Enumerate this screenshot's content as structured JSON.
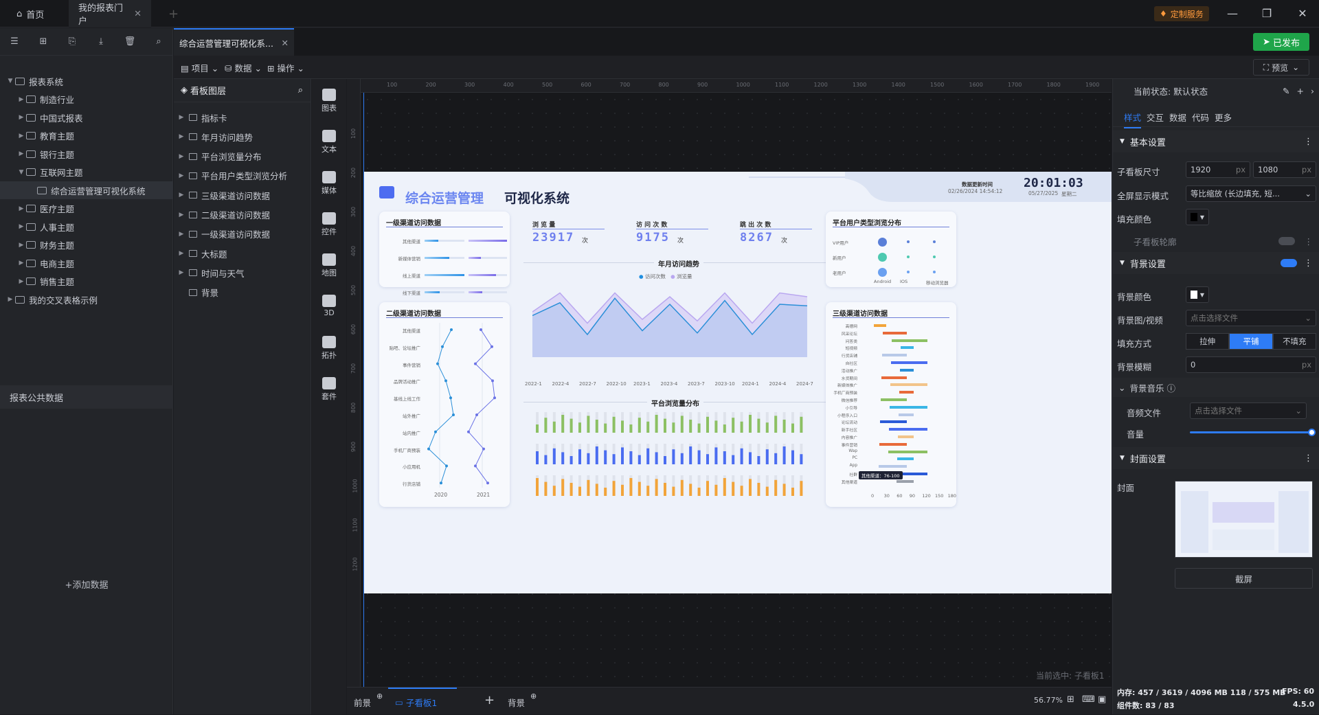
{
  "titlebar": {
    "home": "首页",
    "portal_tab": "我的报表门户",
    "custom_service": "定制服务"
  },
  "sidebar": {
    "tree": [
      {
        "label": "报表系统",
        "level": 0,
        "expanded": true
      },
      {
        "label": "制造行业",
        "level": 1
      },
      {
        "label": "中国式报表",
        "level": 1
      },
      {
        "label": "教育主题",
        "level": 1
      },
      {
        "label": "银行主题",
        "level": 1
      },
      {
        "label": "互联网主题",
        "level": 1,
        "expanded": true
      },
      {
        "label": "综合运营管理可视化系统",
        "level": 2,
        "selected": true
      },
      {
        "label": "医疗主题",
        "level": 1
      },
      {
        "label": "人事主题",
        "level": 1
      },
      {
        "label": "财务主题",
        "level": 1
      },
      {
        "label": "电商主题",
        "level": 1
      },
      {
        "label": "销售主题",
        "level": 1
      },
      {
        "label": "我的交叉表格示例",
        "level": 0
      }
    ],
    "public_data": "报表公共数据",
    "add_data": "+添加数据"
  },
  "doc": {
    "tab": "综合运营管理可视化系...",
    "published": "已发布",
    "preview": "预览"
  },
  "menubar": {
    "project": "项目",
    "data": "数据",
    "operation": "操作"
  },
  "layers": {
    "title": "看板图层",
    "items": [
      "指标卡",
      "年月访问趋势",
      "平台浏览量分布",
      "平台用户类型浏览分析",
      "三级渠道访问数据",
      "二级渠道访问数据",
      "一级渠道访问数据",
      "大标题",
      "时间与天气",
      "背景"
    ]
  },
  "components": [
    "图表",
    "文本",
    "媒体",
    "控件",
    "地图",
    "3D",
    "拓扑",
    "套件"
  ],
  "rulers": {
    "h": [
      "100",
      "200",
      "300",
      "400",
      "500",
      "600",
      "700",
      "800",
      "900",
      "1000",
      "1100",
      "1200",
      "1300",
      "1400",
      "1500",
      "1600",
      "1700",
      "1800",
      "1900"
    ],
    "v": [
      "100",
      "200",
      "300",
      "400",
      "500",
      "600",
      "700",
      "800",
      "900",
      "1000",
      "1100",
      "1200"
    ]
  },
  "board": {
    "title_a": "综合运营管理",
    "title_b": "可视化系统",
    "update_label": "数据更新时间",
    "update_value": "02/26/2024 14:54:12",
    "clock": "20:01:03",
    "date": "05/27/2025",
    "weekday": "星期二",
    "kpis": [
      {
        "label": "浏 览 量",
        "value": "23917",
        "unit": "次"
      },
      {
        "label": "访 问 次 数",
        "value": "9175",
        "unit": "次"
      },
      {
        "label": "跳 出 次 数",
        "value": "8267",
        "unit": "次"
      }
    ],
    "c1_title": "一级渠道访问数据",
    "c1_rows": [
      "其他渠道",
      "新媒体营销",
      "线上渠道",
      "线下渠道"
    ],
    "c2_title": "二级渠道访问数据",
    "c2_rows": [
      "其他渠道",
      "贴吧、论坛推广",
      "事件营销",
      "品牌活动推广",
      "基线上线工作",
      "站外推广",
      "站内推广",
      "手机厂商预装",
      "小应用机",
      "行货店铺"
    ],
    "c2_years": [
      "2020",
      "2021"
    ],
    "c3_title": "平台用户类型浏览分布",
    "c3_rows": [
      "VIP用户",
      "新用户",
      "老用户"
    ],
    "c3_cols": [
      "Android",
      "IOS",
      "移动浏览器"
    ],
    "c4_title": "三级渠道访问数据",
    "c4_rows": [
      "高德网",
      "风采论坛",
      "问答类",
      "短视频",
      "行货店铺",
      "自社区",
      "活动推广",
      "水货期间",
      "新媒体推广",
      "手机厂商预装",
      "微信推荐",
      "小引导",
      "小程序入口",
      "论坛流动",
      "新手社区",
      "内容推广",
      "事件营销",
      "Wap",
      "PC",
      "App",
      "社群",
      "其他渠道"
    ],
    "c4_ticks": [
      "0",
      "30",
      "60",
      "90",
      "120",
      "150",
      "180"
    ],
    "c4_tooltip": "其他渠道：76-100",
    "trend_title": "年月访问趋势",
    "trend_legend": [
      "访问次数",
      "浏览量"
    ],
    "trend_x": [
      "2022-1",
      "2022-4",
      "2022-7",
      "2022-10",
      "2023-1",
      "2023-4",
      "2023-7",
      "2023-10",
      "2024-1",
      "2024-4",
      "2024-7"
    ],
    "dist_title": "平台浏览量分布"
  },
  "canvas_status": "当前选中: 子看板1",
  "bottom": {
    "front": "前景",
    "board": "子看板1",
    "back": "背景",
    "zoom": "56.77%"
  },
  "right": {
    "state_label": "当前状态: 默认状态",
    "tabs": [
      "样式",
      "交互",
      "数据",
      "代码",
      "更多"
    ],
    "basic": "基本设置",
    "size_label": "子看板尺寸",
    "width": "1920",
    "height": "1080",
    "px": "px",
    "fullscreen_label": "全屏显示模式",
    "fullscreen_value": "等比缩放 (长边填充, 短...",
    "fill_label": "填充颜色",
    "outline": "子看板轮廓",
    "bg_section": "背景设置",
    "bg_color": "背景颜色",
    "bg_image": "背景图/视频",
    "bg_image_ph": "点击选择文件",
    "fillmode_label": "填充方式",
    "fillmodes": [
      "拉伸",
      "平铺",
      "不填充"
    ],
    "blur_label": "背景模糊",
    "blur_value": "0",
    "music": "背景音乐",
    "audio_label": "音频文件",
    "audio_ph": "点击选择文件",
    "volume_label": "音量",
    "cover_section": "封面设置",
    "cover_label": "封面",
    "screenshot": "截屏"
  },
  "status": {
    "mem": "内存: 457 / 3619 / 4096 MB  118 / 575 MB",
    "fps": "FPS: 60",
    "count": "组件数: 83 / 83",
    "version": "4.5.0"
  },
  "chart_data": {
    "type": "area",
    "title": "年月访问趋势",
    "categories": [
      "2022-1",
      "2022-4",
      "2022-7",
      "2022-10",
      "2023-1",
      "2023-4",
      "2023-7",
      "2023-10",
      "2024-1",
      "2024-4",
      "2024-7"
    ],
    "series": [
      {
        "name": "访问次数",
        "values": [
          55,
          72,
          30,
          78,
          35,
          70,
          32,
          75,
          30,
          70,
          68
        ]
      },
      {
        "name": "浏览量",
        "values": [
          60,
          85,
          45,
          85,
          50,
          80,
          48,
          85,
          45,
          85,
          80
        ]
      }
    ],
    "ylim": [
      0,
      100
    ]
  }
}
